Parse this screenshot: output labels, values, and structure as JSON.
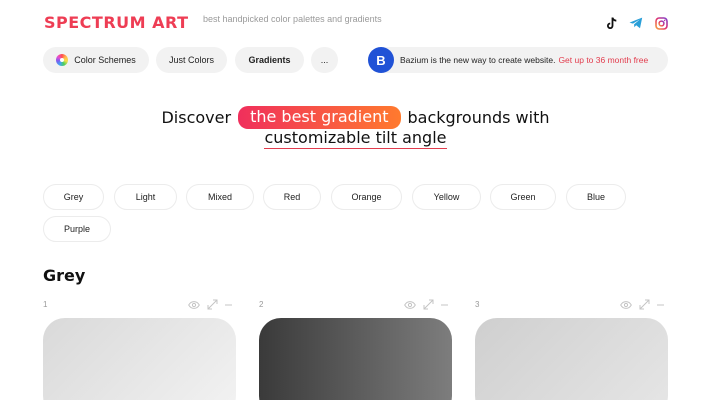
{
  "header": {
    "logo": "SPECTRUM ART",
    "tagline": "best handpicked color palettes and gradients",
    "social_icons": [
      "tiktok-icon",
      "telegram-icon",
      "instagram-icon"
    ]
  },
  "nav": {
    "color_schemes": "Color Schemes",
    "just_colors": "Just Colors",
    "gradients": "Gradients",
    "more": "..."
  },
  "promo": {
    "logo_letter": "B",
    "text": "Bazium is the new way to create website.",
    "link": "Get up to 36 month free"
  },
  "hero": {
    "before": "Discover",
    "highlight": "the best gradient",
    "after": "backgrounds with",
    "line2": "customizable tilt angle"
  },
  "filters": [
    "Grey",
    "Light",
    "Mixed",
    "Red",
    "Orange",
    "Yellow",
    "Green",
    "Blue",
    "Purple"
  ],
  "section": {
    "title": "Grey",
    "cards": [
      {
        "number": "1",
        "colors": [
          "#d9d9d9",
          "#f3f3f3"
        ]
      },
      {
        "number": "2",
        "colors": [
          "#3a3a3a",
          "#7d7d7d"
        ]
      },
      {
        "number": "3",
        "colors": [
          "#cfcfcf",
          "#e6e6e6"
        ]
      }
    ]
  },
  "colors": {
    "accent": "#ee3d54",
    "highlight_start": "#f02f5c",
    "highlight_end": "#ff7a2e",
    "promo_brand": "#2052d6"
  }
}
